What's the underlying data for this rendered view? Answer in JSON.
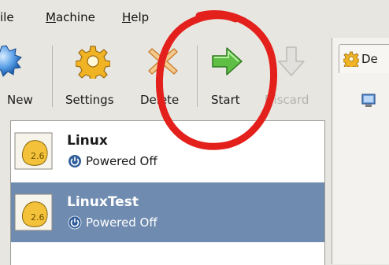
{
  "menubar": {
    "file_label": "ile",
    "machine_label_u": "M",
    "machine_label_rest": "achine",
    "help_label_u": "H",
    "help_label_rest": "elp"
  },
  "toolbar": {
    "new_label": "New",
    "settings_label": "Settings",
    "delete_label": "Delete",
    "start_label": "Start",
    "discard_label": "Discard"
  },
  "vm_list": [
    {
      "name": "Linux",
      "state": "Powered Off",
      "os_badge": "2.6",
      "selected": false
    },
    {
      "name": "LinuxTest",
      "state": "Powered Off",
      "os_badge": "2.6",
      "selected": true
    }
  ],
  "details_tab": {
    "label": "De"
  },
  "colors": {
    "selection": "#6f8bb0",
    "annotation_circle": "#e3201b",
    "start_arrow": "#4aa83a"
  }
}
